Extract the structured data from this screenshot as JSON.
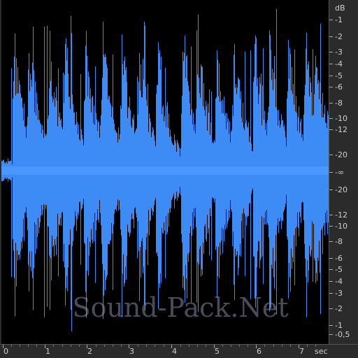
{
  "colors": {
    "waveform": "#3d8cf5",
    "waveform_center": "#4a97ff",
    "background": "#000000",
    "ruler_bg": "#2b2b2b",
    "ruler_text": "#cfcfcf"
  },
  "watermark": "Sound-Pack.Net",
  "db_ruler": {
    "unit": "dB",
    "labels": [
      "-1",
      "-2",
      "-3",
      "-4",
      "-5",
      "-6",
      "-8",
      "-10",
      "-12",
      "-20",
      "-∞",
      "-20",
      "-12",
      "-10",
      "-8",
      "-6",
      "-5",
      "-4",
      "-3",
      "-2",
      "-1",
      "-0,5"
    ]
  },
  "time_ruler": {
    "unit": "sec",
    "labels": [
      "0",
      "1",
      "2",
      "3",
      "4",
      "5",
      "6",
      "7"
    ],
    "duration_sec": 7.6
  },
  "waveform_data": {
    "hit_times_sec": [
      0.25,
      0.6,
      1.08,
      1.45,
      1.95,
      2.35,
      2.8,
      3.2,
      3.65,
      4.25,
      4.6,
      5.05,
      5.45,
      5.95,
      6.3,
      6.75,
      7.15,
      7.4
    ]
  }
}
